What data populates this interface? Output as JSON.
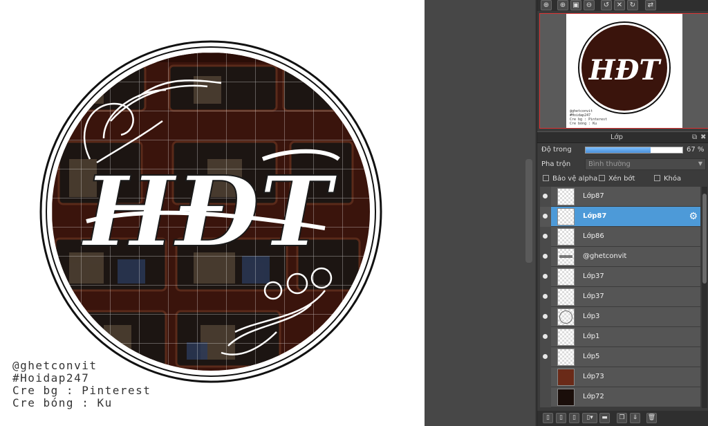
{
  "canvas": {
    "logo_text": "HĐT",
    "credits": [
      "@ghetconvit",
      "#Hoidap247",
      "Cre bg : Pinterest",
      "Cre bóng :  Ku"
    ]
  },
  "navigator": {
    "toolbar_icons": [
      "zoom-fit-icon",
      "zoom-in-icon",
      "fit-window-icon",
      "zoom-out-icon",
      "rotate-left-icon",
      "reset-rotation-icon",
      "rotate-right-icon",
      "flip-icon"
    ]
  },
  "layer_panel": {
    "title": "Lớp",
    "opacity_label": "Độ trong",
    "opacity_value": "67 %",
    "opacity_fraction": 0.67,
    "blend_label": "Pha trộn",
    "blend_value": "Bình thường",
    "protect_alpha_label": "Bảo vệ alpha",
    "clipping_label": "Xén bớt",
    "lock_label": "Khóa",
    "layers": [
      {
        "name": "Lớp87",
        "visible": true,
        "selected": false,
        "thumb": "transparent"
      },
      {
        "name": "Lớp87",
        "visible": true,
        "selected": true,
        "thumb": "transparent"
      },
      {
        "name": "Lớp86",
        "visible": true,
        "selected": false,
        "thumb": "transparent"
      },
      {
        "name": "@ghetconvit",
        "visible": true,
        "selected": false,
        "thumb": "text"
      },
      {
        "name": "Lớp37",
        "visible": true,
        "selected": false,
        "thumb": "transparent"
      },
      {
        "name": "Lớp37",
        "visible": true,
        "selected": false,
        "thumb": "transparent"
      },
      {
        "name": "Lớp3",
        "visible": true,
        "selected": false,
        "thumb": "circle"
      },
      {
        "name": "Lớp1",
        "visible": true,
        "selected": false,
        "thumb": "transparent"
      },
      {
        "name": "Lớp5",
        "visible": true,
        "selected": false,
        "thumb": "transparent"
      },
      {
        "name": "Lớp73",
        "visible": false,
        "selected": false,
        "thumb": "photo"
      },
      {
        "name": "Lớp72",
        "visible": false,
        "selected": false,
        "thumb": "dark"
      }
    ]
  },
  "colors": {
    "selected_row": "#4d9ad8",
    "panel_bg": "#3b3b3b",
    "navigator_border": "#dd3333"
  }
}
